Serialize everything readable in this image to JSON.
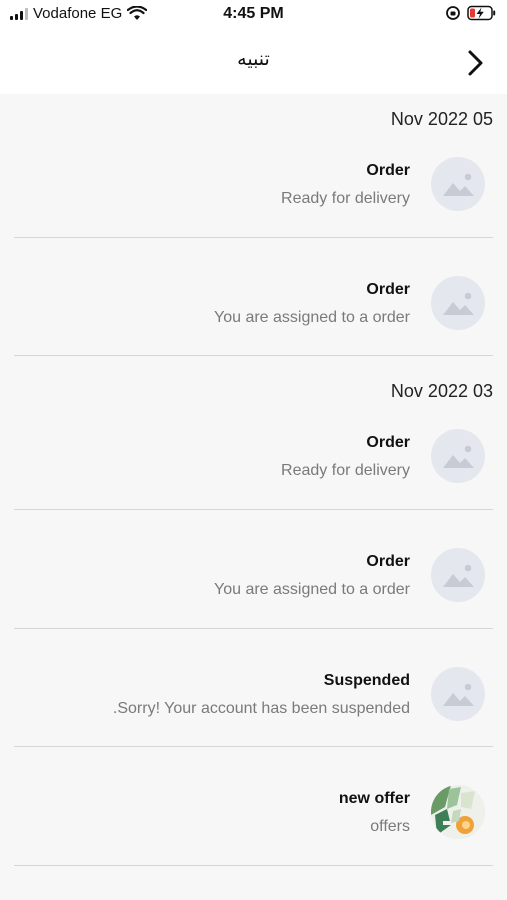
{
  "status_bar": {
    "carrier": "Vodafone EG",
    "time": "4:45 PM"
  },
  "nav": {
    "title": "تنبيه",
    "back_icon": "chevron-right-icon"
  },
  "groups": [
    {
      "date": "Nov 2022 05",
      "items": [
        {
          "title": "Order",
          "body": "Ready for delivery",
          "thumb": "placeholder-image-icon"
        },
        {
          "title": "Order",
          "body": "You are assigned to a order",
          "thumb": "placeholder-image-icon"
        }
      ]
    },
    {
      "date": "Nov 2022 03",
      "items": [
        {
          "title": "Order",
          "body": "Ready for delivery",
          "thumb": "placeholder-image-icon"
        },
        {
          "title": "Order",
          "body": "You are assigned to a order",
          "thumb": "placeholder-image-icon"
        },
        {
          "title": "Suspended",
          "body": ".Sorry! Your account has been suspended",
          "thumb": "placeholder-image-icon"
        },
        {
          "title": "new offer",
          "body": "offers",
          "thumb": "offer-photo"
        }
      ]
    }
  ]
}
